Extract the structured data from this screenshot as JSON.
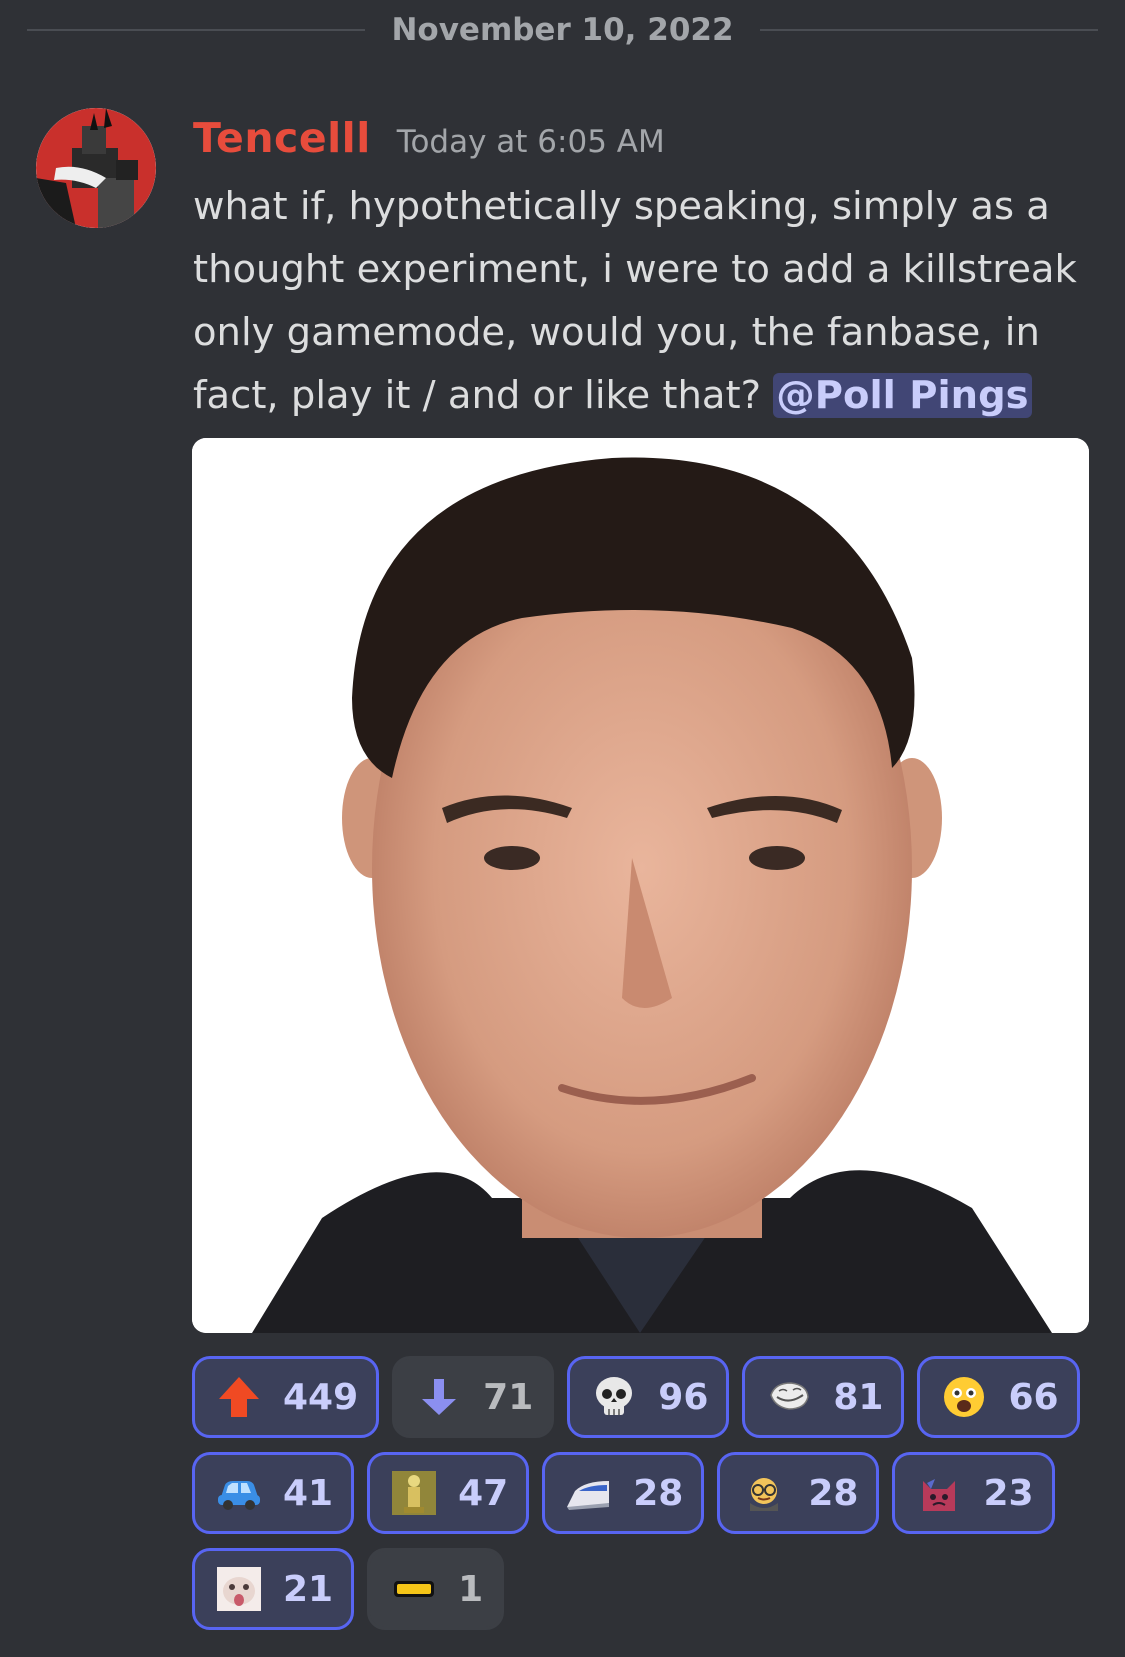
{
  "date_divider": "November 10, 2022",
  "message": {
    "author": "Tencelll",
    "author_color": "#e74c3c",
    "timestamp": "Today at 6:05 AM",
    "text": "what if, hypothetically speaking, simply as a thought experiment, i were to add a killstreak only gamemode, would you, the fanbase, in fact, play it / and or like that?",
    "mention": "@Poll Pings",
    "avatar_icon": "red-circle-roblox-avatar",
    "attachment_icon": "man-portrait-photo"
  },
  "reactions": [
    {
      "emoji": "red-up-arrow",
      "count": "449",
      "me": true
    },
    {
      "emoji": "blue-down-arrow",
      "count": "71",
      "me": false
    },
    {
      "emoji": "skull",
      "count": "96",
      "me": true
    },
    {
      "emoji": "troll-face",
      "count": "81",
      "me": true
    },
    {
      "emoji": "fearful-face",
      "count": "66",
      "me": true
    },
    {
      "emoji": "blue-car",
      "count": "41",
      "me": true
    },
    {
      "emoji": "gold-statue",
      "count": "47",
      "me": true
    },
    {
      "emoji": "bullet-train",
      "count": "28",
      "me": true
    },
    {
      "emoji": "nerd-emote",
      "count": "28",
      "me": true
    },
    {
      "emoji": "red-cat-emote",
      "count": "23",
      "me": true
    },
    {
      "emoji": "cat-photo-emote",
      "count": "21",
      "me": true
    },
    {
      "emoji": "yellow-bar",
      "count": "1",
      "me": false
    }
  ],
  "colors": {
    "background": "#2f3136",
    "accent": "#5865f2",
    "mention_bg": "#414675"
  }
}
